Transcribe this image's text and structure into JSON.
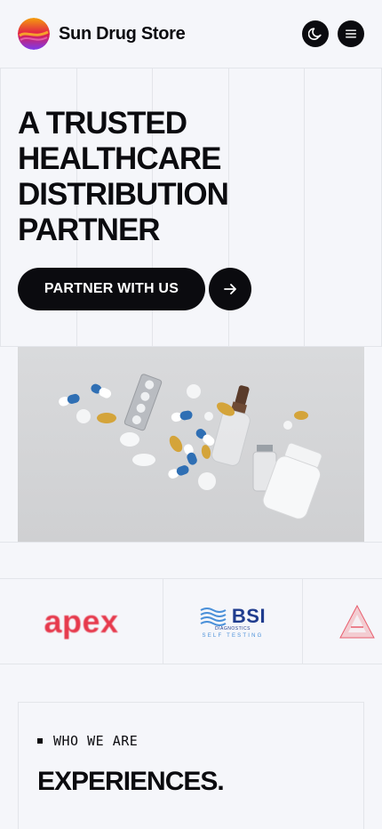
{
  "brand": {
    "name": "Sun Drug Store",
    "colors": {
      "logo_top": "#f59e0b",
      "logo_mid": "#e11d48",
      "logo_bottom": "#7c3aed"
    }
  },
  "header": {
    "theme_toggle_icon": "moon-icon",
    "menu_icon": "hamburger-menu-icon"
  },
  "hero": {
    "title": "A TRUSTED HEALTHCARE DISTRIBUTION PARTNER",
    "cta_label": "PARTNER WITH US",
    "cta_arrow_icon": "arrow-right-icon",
    "image_alt": "Floating pills, capsules, blister pack and medicine bottles"
  },
  "partners": {
    "apex": {
      "name": "apex",
      "color": "#e6394c"
    },
    "bsi": {
      "name": "BSI",
      "sub": "DIAGNOSTICS",
      "tagline": "SELF TESTING",
      "color": "#1f3c8e"
    },
    "third": {
      "icon": "triangle-a-logo",
      "color": "#e6394c"
    }
  },
  "about": {
    "kicker": "WHO WE ARE",
    "heading": "EXPERIENCES."
  },
  "theme": {
    "background": "#f5f6fa",
    "ink": "#0b0b0f",
    "line": "#e3e5ea"
  }
}
